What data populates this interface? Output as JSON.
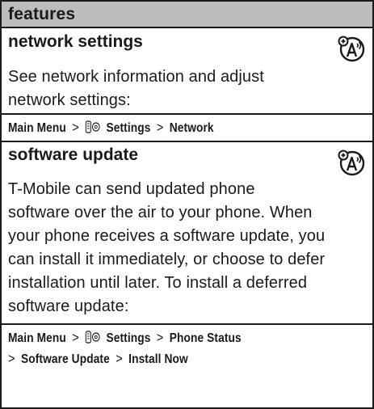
{
  "header": {
    "title": "features"
  },
  "sections": [
    {
      "heading": "network settings",
      "body_lines": [
        "See network information and adjust",
        "network settings:"
      ],
      "nav": {
        "prefix": "Main Menu",
        "sep": ">",
        "item1": "Settings",
        "item2": "Network"
      }
    },
    {
      "heading": "software update",
      "body_lines": [
        "T-Mobile can send updated phone",
        "software over the air to your phone. When",
        "your phone receives a software update, you",
        "can install it immediately, or choose to defer",
        "installation until later. To install a deferred",
        "software update:"
      ],
      "nav_line1": {
        "prefix": "Main Menu",
        "sep": ">",
        "item1": "Settings",
        "item2": "Phone Status"
      },
      "nav_line2": {
        "sep1": ">",
        "item1": "Software Update",
        "sep2": ">",
        "item2": "Install Now"
      }
    }
  ],
  "icons": {
    "network_icon": "network-dependent-feature-icon",
    "settings_icon": "settings-gear-icon"
  }
}
